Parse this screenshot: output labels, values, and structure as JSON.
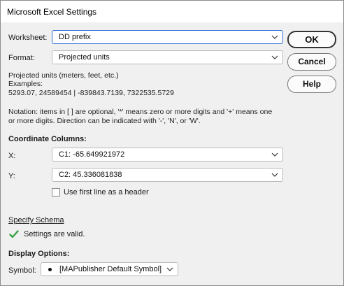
{
  "window": {
    "title": "Microsoft Excel Settings"
  },
  "worksheet": {
    "label": "Worksheet:",
    "value": "DD prefix"
  },
  "format": {
    "label": "Format:",
    "value": "Projected units"
  },
  "buttons": {
    "ok": "OK",
    "cancel": "Cancel",
    "help": "Help"
  },
  "description": {
    "line1": "Projected units (meters, feet, etc.)",
    "line2": "Examples:",
    "line3": "5293.07, 24589454 | -839843.7139, 7322535.5729"
  },
  "notation": {
    "line1": "Notation: items in [ ] are optional, '*' means zero or more digits and '+' means one",
    "line2": "or more digits. Direction can be indicated with '-', 'N', or 'W'."
  },
  "coordinate_columns": {
    "heading": "Coordinate Columns:",
    "x_label": "X:",
    "x_value": "C1: -65.649921972",
    "y_label": "Y:",
    "y_value": "C2: 45.336081838",
    "header_checkbox_label": "Use first line as a header",
    "header_checkbox_checked": false
  },
  "schema": {
    "link": "Specify Schema",
    "status": "Settings are valid.",
    "status_icon": "check-icon",
    "status_color": "#3aa047"
  },
  "display_options": {
    "heading": "Display Options:",
    "symbol_label": "Symbol:",
    "symbol_value": "[MAPublisher Default Symbol]"
  },
  "colors": {
    "focus_border": "#2f6fd6"
  }
}
